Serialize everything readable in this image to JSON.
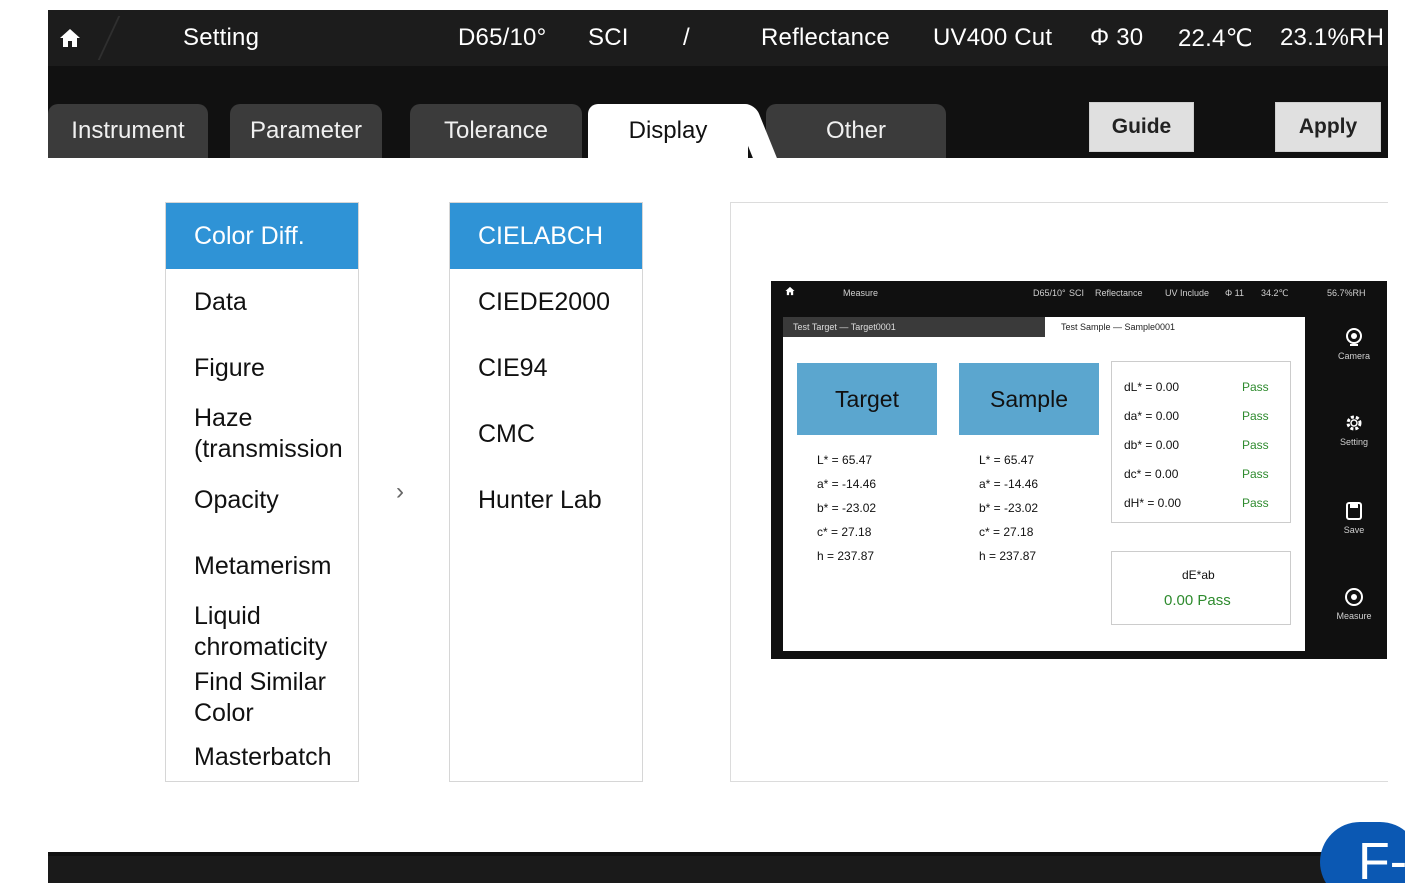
{
  "statusbar": {
    "title": "Setting",
    "illuminant": "D65/10°",
    "specular": "SCI",
    "divider": "/",
    "mode": "Reflectance",
    "uv": "UV400 Cut",
    "aperture": "Φ 30",
    "temperature": "22.4℃",
    "humidity": "23.1%RH"
  },
  "tabs": [
    {
      "label": "Instrument"
    },
    {
      "label": "Parameter"
    },
    {
      "label": "Tolerance"
    },
    {
      "label": "Display",
      "active": true
    },
    {
      "label": "Other"
    }
  ],
  "buttons": {
    "guide": "Guide",
    "apply": "Apply"
  },
  "categories": [
    {
      "label": "Color Diff.",
      "selected": true
    },
    {
      "label": "Data"
    },
    {
      "label": "Figure"
    },
    {
      "label": "Haze (transmission"
    },
    {
      "label": "Opacity"
    },
    {
      "label": "Metamerism"
    },
    {
      "label": "Liquid chromaticity"
    },
    {
      "label": "Find Similar Color"
    },
    {
      "label": "Masterbatch"
    }
  ],
  "formulas": [
    {
      "label": "CIELABCH",
      "selected": true
    },
    {
      "label": "CIEDE2000"
    },
    {
      "label": "CIE94"
    },
    {
      "label": "CMC"
    },
    {
      "label": "Hunter Lab"
    }
  ],
  "arrow": "›",
  "preview": {
    "bar": {
      "title": "Measure",
      "illuminant": "D65/10°",
      "specular": "SCI",
      "mode": "Reflectance",
      "uv": "UV Include",
      "aperture": "Φ 11",
      "temperature": "34.2℃",
      "humidity": "56.7%RH"
    },
    "tab_target": "Test Target — Target0001",
    "tab_sample": "Test Sample — Sample0001",
    "target_label": "Target",
    "sample_label": "Sample",
    "target_values": [
      "L*  =  65.47",
      "a*  =  -14.46",
      "b*  =  -23.02",
      "c*  =  27.18",
      "h   =  237.87"
    ],
    "sample_values": [
      "L*  =  65.47",
      "a*  =  -14.46",
      "b*  =  -23.02",
      "c*  =  27.18",
      "h   =  237.87"
    ],
    "diffs": [
      {
        "label": "dL* =  0.00",
        "status": "Pass"
      },
      {
        "label": "da* =  0.00",
        "status": "Pass"
      },
      {
        "label": "db* =  0.00",
        "status": "Pass"
      },
      {
        "label": "dc* =  0.00",
        "status": "Pass"
      },
      {
        "label": "dH* =  0.00",
        "status": "Pass"
      }
    ],
    "de_label": "dE*ab",
    "de_value": "0.00 Pass",
    "side": [
      "Camera",
      "Setting",
      "Save",
      "Measure"
    ]
  },
  "badge": "F-",
  "colors": {
    "accent": "#2f93d6",
    "pass": "#2e8b2e",
    "preview_button": "#5ba6cf",
    "badge": "#0b58b3"
  }
}
